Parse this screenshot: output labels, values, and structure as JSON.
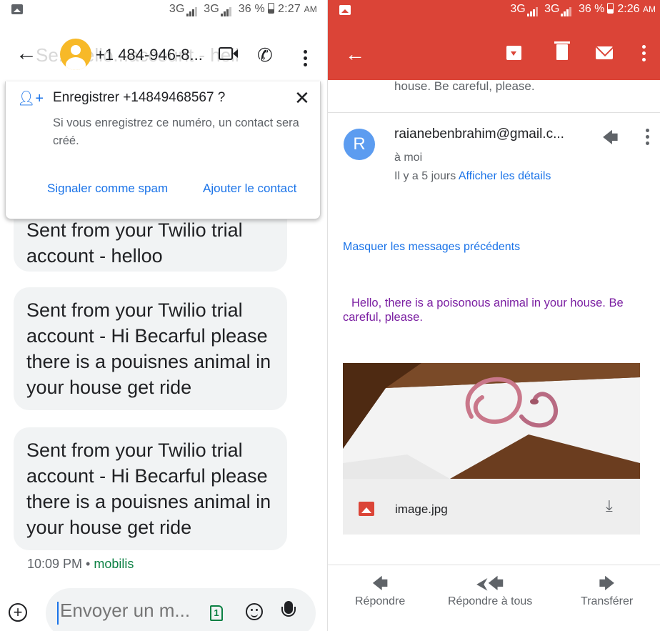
{
  "left": {
    "status_bar": {
      "text": "3G 3G 36 % 2:27 AM",
      "network1": "3G",
      "network2": "3G",
      "battery": "36 %",
      "time": "2:27",
      "ampm": "AM"
    },
    "app_bar": {
      "title": "+1 484-946-8...",
      "ghost_text": "Se...hello...account - hell"
    },
    "popup": {
      "title": "Enregistrer +14849468567 ?",
      "body": "Si vous enregistrez ce numéro, un contact sera créé.",
      "spam_label": "Signaler comme spam",
      "add_label": "Ajouter le contact"
    },
    "messages": [
      {
        "text": "Sent from your Twilio trial account - helloo"
      },
      {
        "text": "Sent from your Twilio trial account - Hi Becarful please there is a pouisnes animal in your house get ride"
      },
      {
        "text": "Sent from your Twilio trial account - Hi Becarful please there is a pouisnes animal in your house get ride"
      }
    ],
    "meta": {
      "time": "10:09 PM",
      "sep": " • ",
      "carrier": "mobilis"
    },
    "compose": {
      "placeholder": "Envoyer un m...",
      "sim_slot": "1"
    }
  },
  "right": {
    "status_bar": {
      "text": "3G 3G 36 % 2:26 AM",
      "time": "2:26",
      "ampm": "AM"
    },
    "snippet": "house. Be careful, please.",
    "email": {
      "avatar_letter": "R",
      "sender": "raianebenbrahim@gmail.c...",
      "to": "à moi",
      "when": "Il y a 5 jours",
      "details_link": "Afficher les détails",
      "hide_label": "Masquer les messages précédents",
      "body": "Hello, there is a poisonous animal in your house. Be careful, please."
    },
    "attachment": {
      "name": "image.jpg"
    },
    "actions": [
      {
        "label": "Répondre",
        "icon": "reply-icon"
      },
      {
        "label": "Répondre à tous",
        "icon": "reply-all-icon"
      },
      {
        "label": "Transférer",
        "icon": "forward-icon"
      }
    ]
  },
  "colors": {
    "gmail_red": "#db4437",
    "link_blue": "#1a73e8",
    "body_purple": "#7b1fa2",
    "carrier_green": "#0b8043",
    "avatar_yellow": "#f7b928"
  }
}
